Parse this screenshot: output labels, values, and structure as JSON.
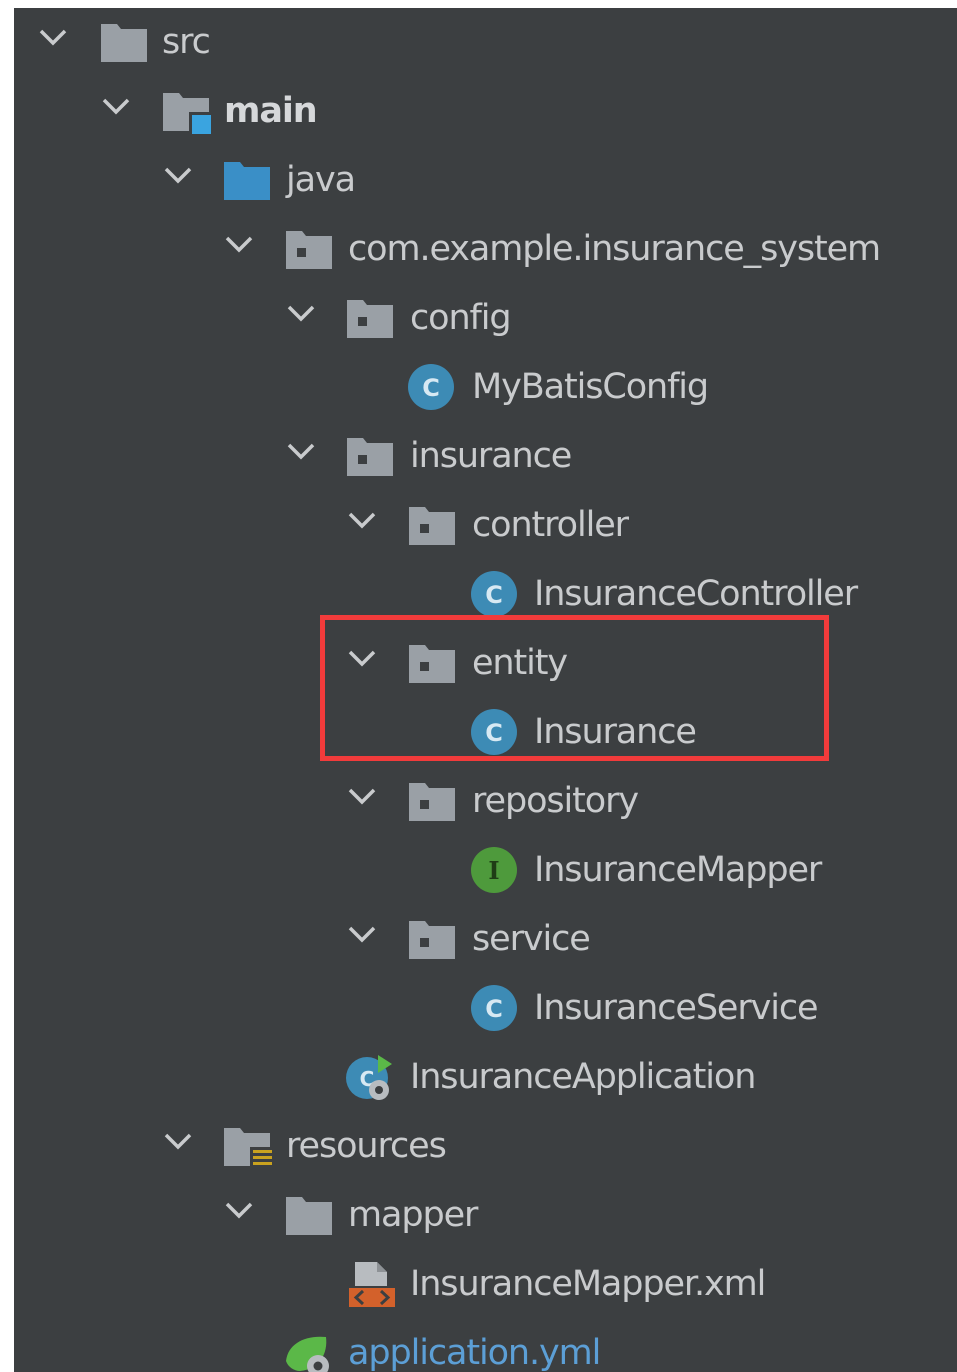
{
  "colors": {
    "background": "#3c3f41",
    "text": "#c9cbcd",
    "folder": "#9aa0a6",
    "source_folder": "#3a8fc7",
    "class_icon": "#3d8bb5",
    "interface_icon": "#4e9a3c",
    "highlight_box": "#f23b3b",
    "link_text": "#5c9fd6"
  },
  "tree": {
    "src": "src",
    "main": "main",
    "java": "java",
    "package_root": "com.example.insurance_system",
    "config": "config",
    "mybatis_config": "MyBatisConfig",
    "insurance": "insurance",
    "controller": "controller",
    "insurance_controller": "InsuranceController",
    "entity": "entity",
    "insurance_class": "Insurance",
    "repository": "repository",
    "insurance_mapper": "InsuranceMapper",
    "service": "service",
    "insurance_service": "InsuranceService",
    "insurance_application": "InsuranceApplication",
    "resources": "resources",
    "mapper": "mapper",
    "insurance_mapper_xml": "InsuranceMapper.xml",
    "application_yml": "application.yml"
  },
  "glyphs": {
    "class": "C",
    "interface": "I"
  },
  "icons": {
    "expand": "chevron-down-icon",
    "folder": "folder-icon",
    "source_root": "source-root-folder-icon",
    "java_source": "java-source-folder-icon",
    "package": "package-icon",
    "class": "class-icon",
    "interface": "interface-icon",
    "spring_boot_app": "spring-boot-app-icon",
    "resources_root": "resources-folder-icon",
    "xml_file": "xml-file-icon",
    "yaml_file": "spring-yaml-file-icon"
  }
}
